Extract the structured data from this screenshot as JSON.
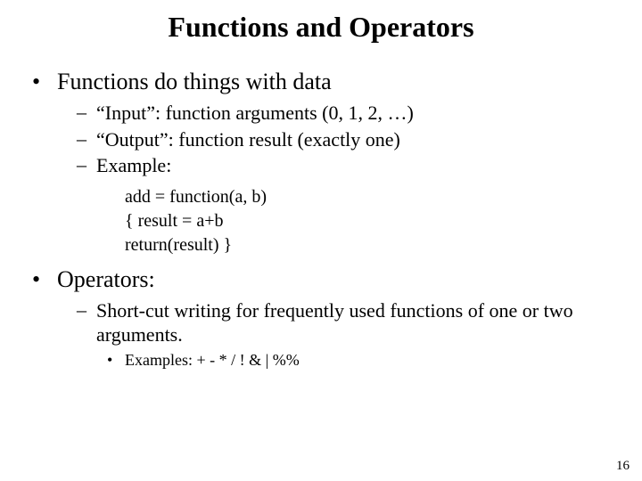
{
  "title": "Functions and Operators",
  "b1": {
    "text": "Functions do things with data"
  },
  "b1s": {
    "a": "“Input”: function arguments (0, 1, 2, …)",
    "b": "“Output”: function result (exactly one)",
    "c": "Example:"
  },
  "code": {
    "l1": "add = function(a, b)",
    "l2": "{ result = a+b",
    "l3": "return(result) }"
  },
  "b2": {
    "text": "Operators:"
  },
  "b2s": {
    "a": "Short-cut writing for frequently used functions of one or two arguments."
  },
  "b2s2": {
    "a": "Examples: + - * / ! & | %%"
  },
  "pagenum": "16"
}
